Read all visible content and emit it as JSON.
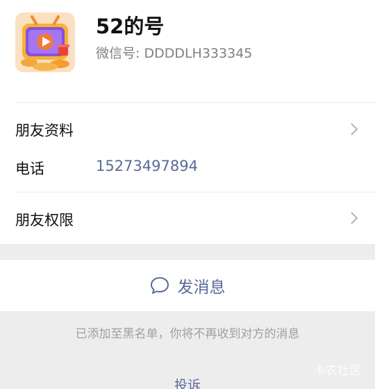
{
  "profile": {
    "display_name": "52的号",
    "wechat_id": "微信号: DDDDLH333345"
  },
  "rows": {
    "friend_profile_label": "朋友资料",
    "phone_label": "电话",
    "phone_value": "15273497894",
    "friend_permissions_label": "朋友权限"
  },
  "actions": {
    "send_message_label": "发消息",
    "report_label": "投诉"
  },
  "notice": {
    "blacklist_text": "已添加至黑名单，你将不再收到对方的消息"
  },
  "watermark": {
    "text": "卡农社区"
  },
  "icons": {
    "avatar": "video-app-icon",
    "chevron": "chevron-right-icon",
    "message": "chat-bubble-icon"
  },
  "colors": {
    "link_blue": "#576b95",
    "background_gray": "#ededed",
    "text_primary": "#111111",
    "text_secondary": "#808080"
  }
}
